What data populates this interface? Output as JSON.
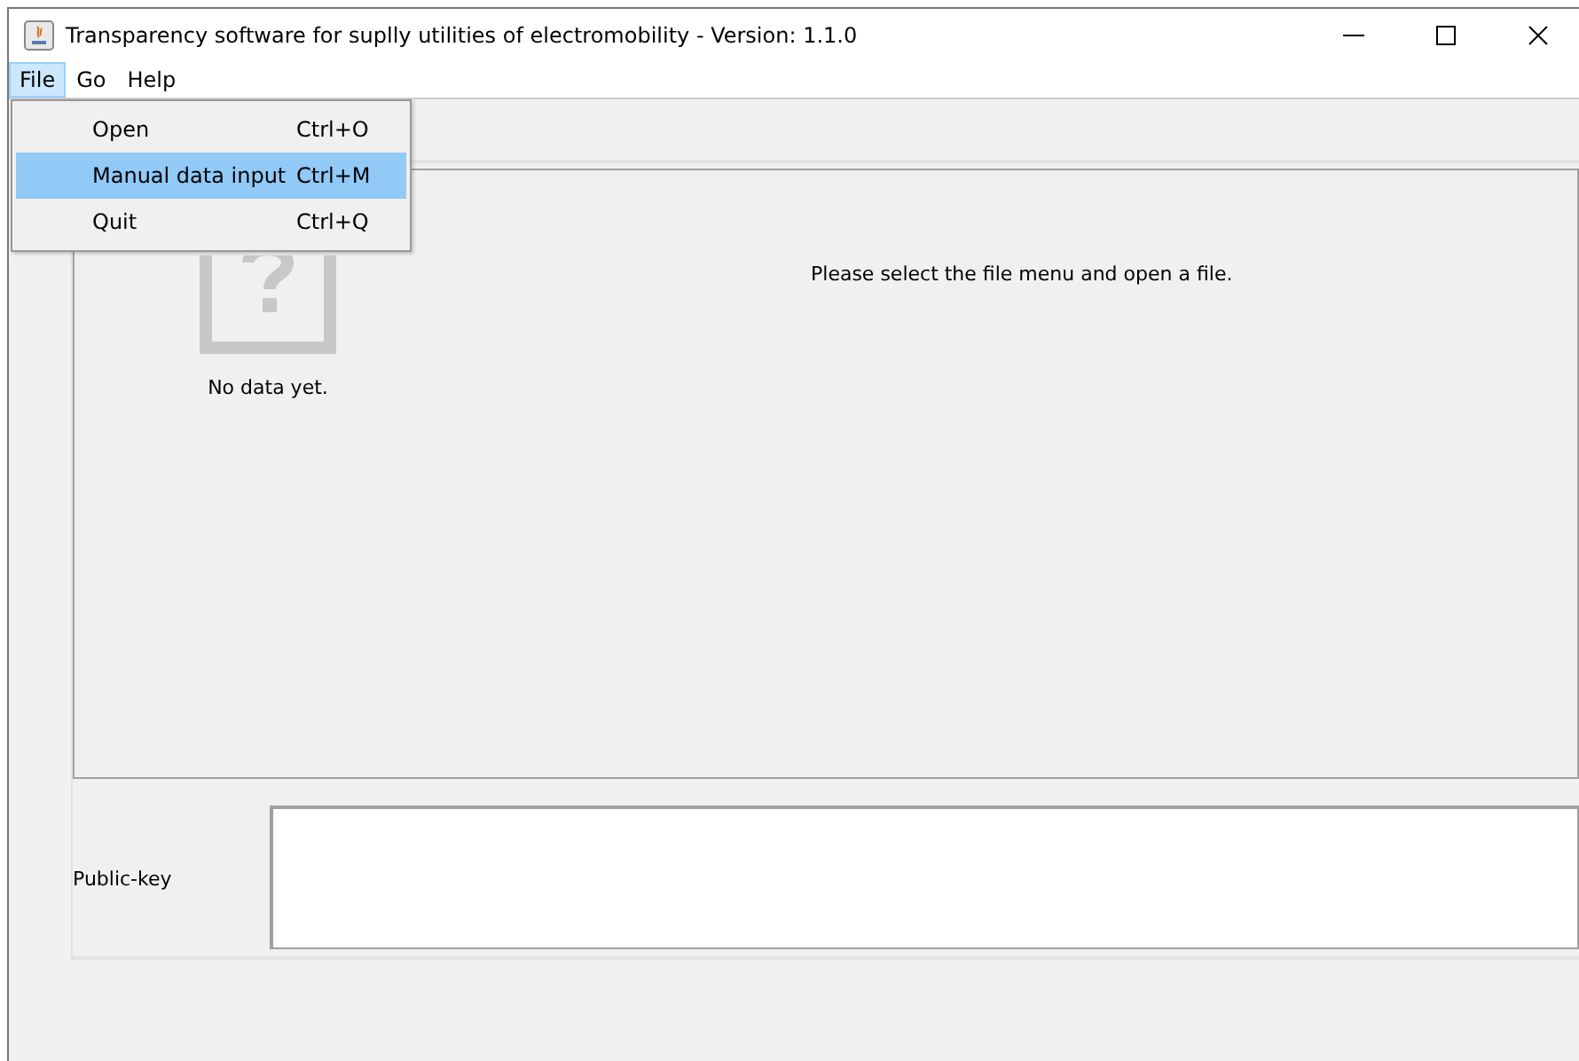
{
  "window": {
    "title": "Transparency software for suplly utilities of electromobility - Version: 1.1.0"
  },
  "menu_bar": [
    {
      "label": "File",
      "open": true,
      "items": [
        {
          "label": "Open",
          "shortcut": "Ctrl+O",
          "selected": false
        },
        {
          "label": "Manual data input",
          "shortcut": "Ctrl+M",
          "selected": true
        },
        {
          "label": "Quit",
          "shortcut": "Ctrl+Q",
          "selected": false
        }
      ]
    },
    {
      "label": "Go",
      "open": false
    },
    {
      "label": "Help",
      "open": false
    }
  ],
  "preview": {
    "empty_label": "No data yet.",
    "message": "Please select the file menu and open a file."
  },
  "public_key": {
    "label": "Public-key"
  }
}
